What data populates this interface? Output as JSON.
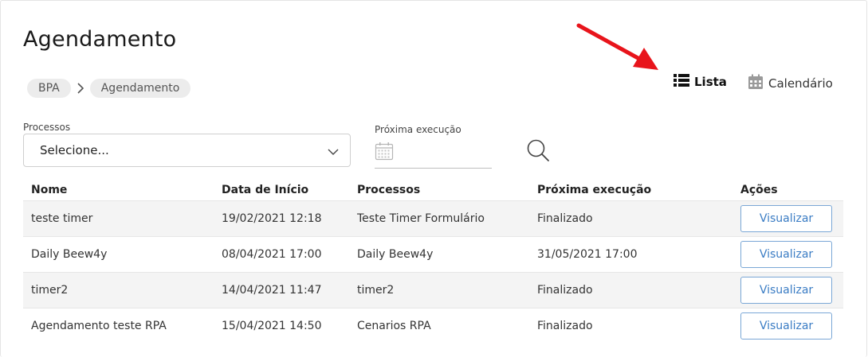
{
  "page": {
    "title": "Agendamento"
  },
  "breadcrumb": [
    {
      "label": "BPA"
    },
    {
      "label": "Agendamento"
    }
  ],
  "view_toggle": {
    "list_label": "Lista",
    "calendar_label": "Calendário",
    "active": "list"
  },
  "filters": {
    "processes_label": "Processos",
    "processes_value": "Selecione...",
    "next_exec_label": "Próxima execução",
    "next_exec_value": ""
  },
  "table": {
    "headers": [
      "Nome",
      "Data de Início",
      "Processos",
      "Próxima execução",
      "Ações"
    ],
    "rows": [
      {
        "nome": "teste timer",
        "data_inicio": "19/02/2021 12:18",
        "processos": "Teste Timer Formulário",
        "proxima": "Finalizado",
        "acao": "Visualizar"
      },
      {
        "nome": "Daily Beew4y",
        "data_inicio": "08/04/2021 17:00",
        "processos": "Daily Beew4y",
        "proxima": "31/05/2021 17:00",
        "acao": "Visualizar"
      },
      {
        "nome": "timer2",
        "data_inicio": "14/04/2021 11:47",
        "processos": "timer2",
        "proxima": "Finalizado",
        "acao": "Visualizar"
      },
      {
        "nome": "Agendamento teste RPA",
        "data_inicio": "15/04/2021 14:50",
        "processos": "Cenarios RPA",
        "proxima": "Finalizado",
        "acao": "Visualizar"
      }
    ]
  },
  "colors": {
    "accent": "#3a7cc4",
    "annotation_arrow": "#e8141b",
    "row_stripe": "#f4f4f4"
  }
}
